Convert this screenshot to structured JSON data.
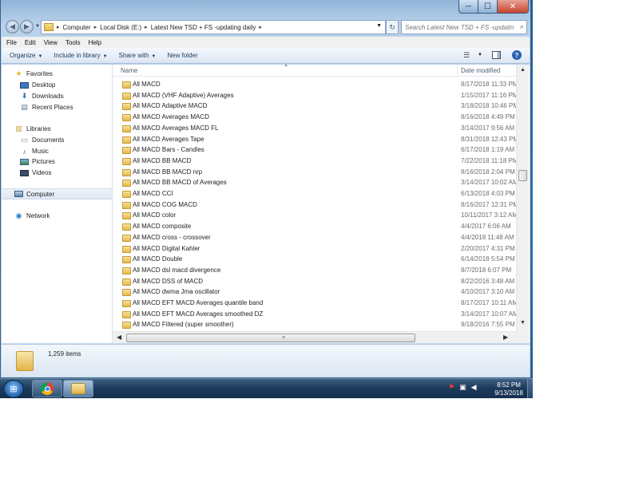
{
  "window": {
    "controls": {
      "minimize": "─",
      "maximize": "☐",
      "close": "✕"
    }
  },
  "address_bar": {
    "back_glyph": "◀",
    "forward_glyph": "▶",
    "breadcrumbs": [
      "Computer",
      "Local Disk (E:)",
      "Latest New TSD + FS -updating daily"
    ],
    "separator": "▸",
    "dropdown_glyph": "▼",
    "refresh_glyph": "↻",
    "search_placeholder": "Search Latest New TSD + FS -updatin...",
    "search_glyph": "⌕"
  },
  "menu": [
    "File",
    "Edit",
    "View",
    "Tools",
    "Help"
  ],
  "command_bar": {
    "organize": "Organize",
    "include_in_library": "Include in library",
    "share_with": "Share with",
    "new_folder": "New folder",
    "caret": "▼",
    "help": "?"
  },
  "nav_pane": {
    "favorites": {
      "label": "Favorites",
      "items": [
        "Desktop",
        "Downloads",
        "Recent Places"
      ]
    },
    "libraries": {
      "label": "Libraries",
      "items": [
        "Documents",
        "Music",
        "Pictures",
        "Videos"
      ]
    },
    "computer": "Computer",
    "network": "Network"
  },
  "file_list": {
    "columns": {
      "name": "Name",
      "date_modified": "Date modified"
    },
    "rows": [
      {
        "name": "All  MACD",
        "date": "8/17/2018 11:33 PM"
      },
      {
        "name": "All  MACD (VHF Adaptive) Averages",
        "date": "1/15/2017 11:16 PM"
      },
      {
        "name": "All  MACD Adaptive MACD",
        "date": "3/18/2018 10:46 PM"
      },
      {
        "name": "All  MACD Averages MACD",
        "date": "8/16/2018 4:49 PM"
      },
      {
        "name": "All  MACD Averages MACD FL",
        "date": "3/14/2017 9:56 AM"
      },
      {
        "name": "All  MACD Averages Tape",
        "date": "8/31/2018 12:43 PM"
      },
      {
        "name": "All  MACD Bars - Candles",
        "date": "6/17/2018 1:19 AM"
      },
      {
        "name": "All  MACD BB MACD",
        "date": "7/22/2018 11:18 PM"
      },
      {
        "name": "All  MACD BB MACD nrp",
        "date": "8/16/2018 2:04 PM"
      },
      {
        "name": "All  MACD BB MACD of Averages",
        "date": "3/14/2017 10:02 AM"
      },
      {
        "name": "All  MACD CCI",
        "date": "6/13/2018 4:03 PM"
      },
      {
        "name": "All  MACD COG MACD",
        "date": "8/16/2017 12:31 PM"
      },
      {
        "name": "All  MACD color",
        "date": "10/11/2017 3:12 AM"
      },
      {
        "name": "All  MACD composite",
        "date": "4/4/2017 6:06 AM"
      },
      {
        "name": "All  MACD cross - crossover",
        "date": "4/4/2018 11:48 AM"
      },
      {
        "name": "All  MACD Digital Kahler",
        "date": "2/20/2017 4:31 PM"
      },
      {
        "name": "All  MACD Double",
        "date": "6/14/2018 5:54 PM"
      },
      {
        "name": "All  MACD dsl macd divergence",
        "date": "8/7/2018 6:07 PM"
      },
      {
        "name": "All  MACD DSS of MACD",
        "date": "8/22/2016 3:48 AM"
      },
      {
        "name": "All  MACD dwma Jma oscillator",
        "date": "4/10/2017 3:10 AM"
      },
      {
        "name": "All  MACD EFT MACD Averages quantile band",
        "date": "8/17/2017 10:11 AM"
      },
      {
        "name": "All  MACD EFT MACD Averages smoothed DZ",
        "date": "3/14/2017 10:07 AM"
      },
      {
        "name": "All  MACD Filtered (super smoother)",
        "date": "9/18/2016 7:55 PM"
      }
    ]
  },
  "status": {
    "item_count": "1,259 items"
  },
  "taskbar": {
    "start_glyph": "⊞",
    "clock_time": "8:52 PM",
    "clock_date": "9/13/2018"
  },
  "icons": [
    "back-icon",
    "forward-icon",
    "refresh-icon",
    "search-icon",
    "star-icon",
    "folder-icon",
    "library-icon",
    "computer-icon",
    "network-icon",
    "chrome-icon",
    "explorer-icon",
    "flag-icon",
    "volume-icon",
    "help-icon"
  ],
  "colors": {
    "accent": "#1e395b",
    "folder": "#e4b94c",
    "taskbar": "#1e3b5c",
    "selection": "#dfe8f3"
  }
}
